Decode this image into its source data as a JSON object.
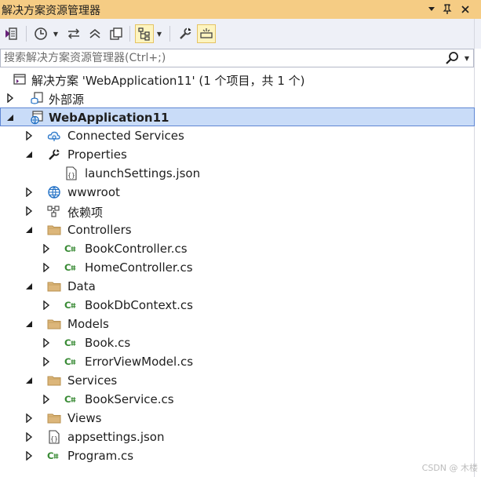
{
  "title_bar": {
    "title": "解决方案资源管理器",
    "controls": [
      "dropdown-icon",
      "pin-icon",
      "close-icon"
    ]
  },
  "toolbar": {
    "tools": [
      "vs-switch-views-icon",
      "history-icon",
      "sync-icon",
      "collapse-all-icon",
      "show-all-files-icon",
      "view-hierarchy-icon",
      "properties-wrench-icon",
      "preview-selected-icon"
    ]
  },
  "search": {
    "placeholder": "搜索解决方案资源管理器(Ctrl+;)",
    "value": ""
  },
  "tree": {
    "items": [
      {
        "label": "解决方案 'WebApplication11' (1 个项目，共 1 个)",
        "icon": "solution-icon",
        "expander": "none",
        "depth": 0
      },
      {
        "label": "外部源",
        "icon": "external-sources-icon",
        "expander": "collapsed",
        "depth": 0
      },
      {
        "label": "WebApplication11",
        "icon": "web-project-icon",
        "expander": "expanded",
        "depth": 0,
        "selected": true
      },
      {
        "label": "Connected Services",
        "icon": "connected-services-icon",
        "expander": "collapsed",
        "depth": 1
      },
      {
        "label": "Properties",
        "icon": "wrench-icon",
        "expander": "expanded",
        "depth": 1
      },
      {
        "label": "launchSettings.json",
        "icon": "json-file-icon",
        "expander": "none",
        "depth": 2
      },
      {
        "label": "wwwroot",
        "icon": "globe-icon",
        "expander": "collapsed",
        "depth": 1
      },
      {
        "label": "依赖项",
        "icon": "dependencies-icon",
        "expander": "collapsed",
        "depth": 1
      },
      {
        "label": "Controllers",
        "icon": "folder-icon",
        "expander": "expanded",
        "depth": 1
      },
      {
        "label": "BookController.cs",
        "icon": "csharp-file-icon",
        "expander": "collapsed",
        "depth": 2
      },
      {
        "label": "HomeController.cs",
        "icon": "csharp-file-icon",
        "expander": "collapsed",
        "depth": 2
      },
      {
        "label": "Data",
        "icon": "folder-icon",
        "expander": "expanded",
        "depth": 1
      },
      {
        "label": "BookDbContext.cs",
        "icon": "csharp-file-icon",
        "expander": "collapsed",
        "depth": 2
      },
      {
        "label": "Models",
        "icon": "folder-icon",
        "expander": "expanded",
        "depth": 1
      },
      {
        "label": "Book.cs",
        "icon": "csharp-file-icon",
        "expander": "collapsed",
        "depth": 2
      },
      {
        "label": "ErrorViewModel.cs",
        "icon": "csharp-file-icon",
        "expander": "collapsed",
        "depth": 2
      },
      {
        "label": "Services",
        "icon": "folder-icon",
        "expander": "expanded",
        "depth": 1
      },
      {
        "label": "BookService.cs",
        "icon": "csharp-file-icon",
        "expander": "collapsed",
        "depth": 2
      },
      {
        "label": "Views",
        "icon": "folder-icon",
        "expander": "collapsed",
        "depth": 1
      },
      {
        "label": "appsettings.json",
        "icon": "json-file-icon",
        "expander": "collapsed",
        "depth": 1
      },
      {
        "label": "Program.cs",
        "icon": "csharp-file-icon",
        "expander": "collapsed",
        "depth": 1
      }
    ]
  },
  "watermark": "CSDN @ 木楼",
  "colors": {
    "title_bar": "#f5cc84",
    "toolbar": "#eef0f7",
    "selection_bg": "#c9dcf8",
    "selection_border": "#5f86d3",
    "folder": "#dcb67a",
    "csharp": "#388a34"
  }
}
